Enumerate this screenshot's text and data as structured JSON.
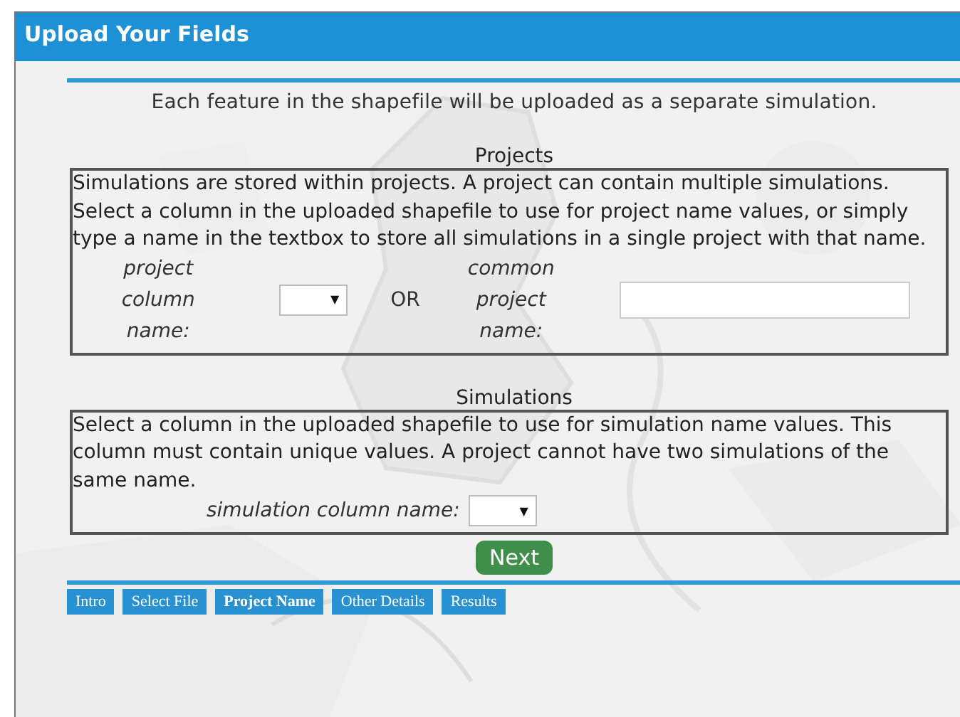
{
  "window": {
    "title": "Upload Your Fields"
  },
  "intro": "Each feature in the shapefile will be uploaded as a separate simulation.",
  "projects": {
    "heading": "Projects",
    "description": "Simulations are stored within projects. A project can contain multiple simulations. Select a column in the uploaded shapefile to use for project name values, or simply type a name in the textbox to store all simulations in a single project with that name.",
    "column_label": "project column name:",
    "dropdown_arrow": "▼",
    "or_label": "OR",
    "common_label": "common project name:"
  },
  "simulations": {
    "heading": "Simulations",
    "description": "Select a column in the uploaded shapefile to use for simulation name values. This column must contain unique values. A project cannot have two simulations of the same name.",
    "column_label": "simulation column name:",
    "dropdown_arrow": "▼"
  },
  "next_button": "Next",
  "steps": [
    {
      "label": "Intro",
      "selected": false
    },
    {
      "label": "Select File",
      "selected": false
    },
    {
      "label": "Project Name",
      "selected": true
    },
    {
      "label": "Other Details",
      "selected": false
    },
    {
      "label": "Results",
      "selected": false
    }
  ]
}
